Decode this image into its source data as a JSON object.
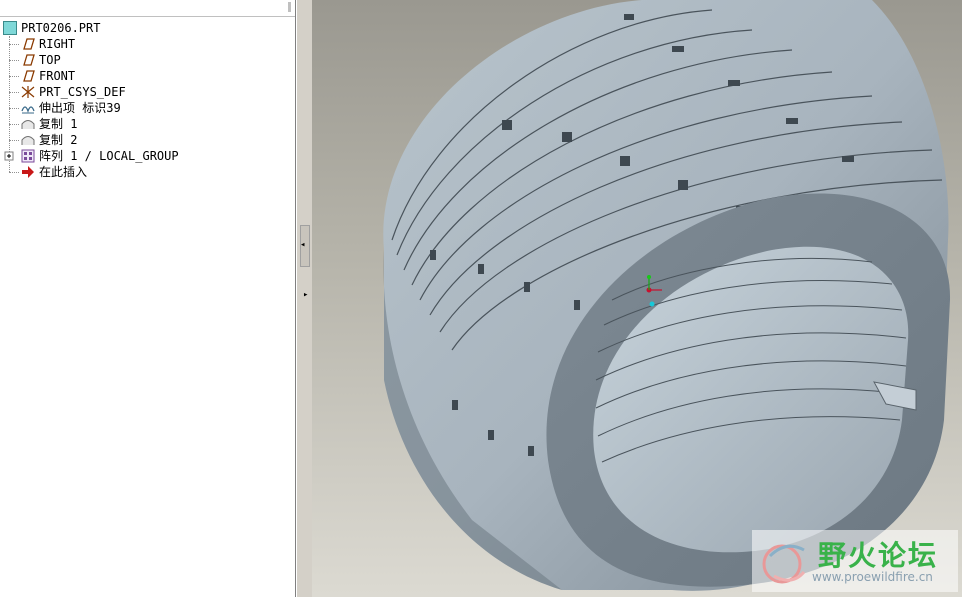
{
  "model_tree": {
    "root": "PRT0206.PRT",
    "items": [
      {
        "label": "RIGHT",
        "icon": "datum-plane-icon"
      },
      {
        "label": "TOP",
        "icon": "datum-plane-icon"
      },
      {
        "label": "FRONT",
        "icon": "datum-plane-icon"
      },
      {
        "label": "PRT_CSYS_DEF",
        "icon": "coordinate-system-icon"
      },
      {
        "label": "伸出项 标识39",
        "icon": "protrusion-icon"
      },
      {
        "label": "复制 1",
        "icon": "copy-feature-icon"
      },
      {
        "label": "复制 2",
        "icon": "copy-feature-icon"
      },
      {
        "label": "阵列 1 / LOCAL_GROUP",
        "icon": "pattern-icon"
      },
      {
        "label": "在此插入",
        "icon": "insert-here-arrow-icon"
      }
    ]
  },
  "watermark": {
    "title": "野火论坛",
    "url": "www.proewildfire.cn"
  },
  "colors": {
    "model_fill": "#8c98a2",
    "model_light": "#c4d0d8",
    "viewport_top": "#9a9890",
    "viewport_bottom": "#dcdad2",
    "watermark_green": "#39b24a"
  }
}
